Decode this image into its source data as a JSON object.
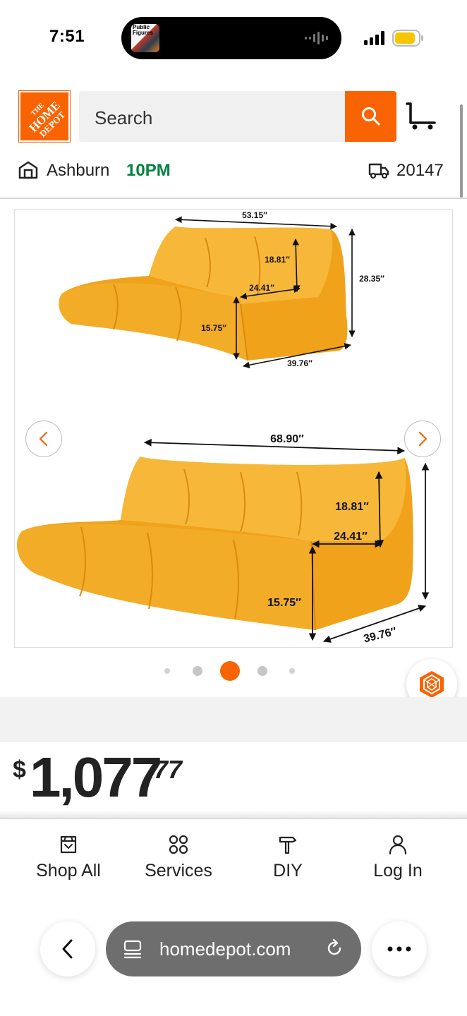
{
  "status_bar": {
    "time": "7:51",
    "island_art_text": "Public Figures"
  },
  "header": {
    "logo_text": "THE HOME DEPOT",
    "search_placeholder": "Search",
    "store_name": "Ashburn",
    "store_hours": "10PM",
    "zip": "20147"
  },
  "gallery": {
    "dimensions_small": {
      "width": "53.15″",
      "back_height": "18.81″",
      "seat_depth": "24.41″",
      "total_height": "28.35″",
      "seat_height": "15.75″",
      "depth": "39.76″"
    },
    "dimensions_large": {
      "width": "68.90″",
      "back_height": "18.81″",
      "seat_depth": "24.41″",
      "seat_height": "15.75″",
      "depth": "39.76″"
    },
    "dot_count": 5,
    "active_index": 2
  },
  "price": {
    "dollar_sign": "$",
    "whole": "1,077",
    "cents": "77"
  },
  "bottom_nav": {
    "shop_all": "Shop All",
    "services": "Services",
    "diy": "DIY",
    "log_in": "Log In"
  },
  "browser": {
    "url": "homedepot.com"
  },
  "colors": {
    "brand_orange": "#f96302",
    "hours_green": "#00833f",
    "sofa_yellow": "#f5a81c"
  }
}
